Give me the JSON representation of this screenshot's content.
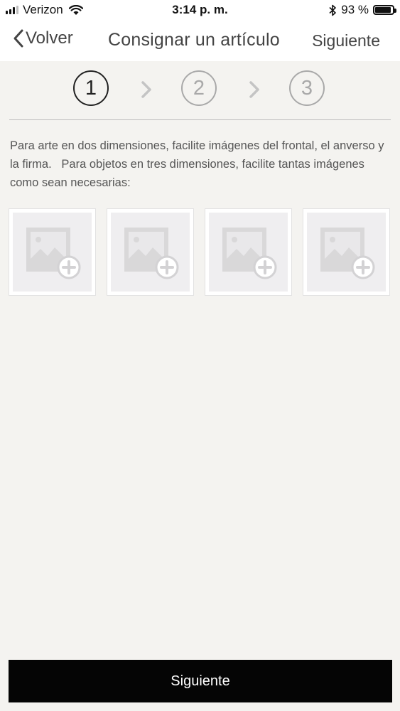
{
  "status_bar": {
    "carrier": "Verizon",
    "time": "3:14 p. m.",
    "battery_percent": "93 %",
    "battery_level": 0.93,
    "icons": [
      "signal-icon",
      "wifi-icon",
      "bluetooth-icon",
      "battery-icon"
    ]
  },
  "nav": {
    "back_label": "Volver",
    "title": "Consignar un artículo",
    "next_label": "Siguiente",
    "icons": [
      "chevron-left-icon"
    ]
  },
  "steps": [
    {
      "label": "1",
      "state": "active"
    },
    {
      "label": "2",
      "state": "inactive"
    },
    {
      "label": "3",
      "state": "inactive"
    }
  ],
  "instructions": "Para arte en dos dimensiones, facilite imágenes del frontal, el anverso y la firma.   Para objetos en tres dimensiones, facilite tantas imágenes como sean necesarias:",
  "image_slots": [
    {
      "icon": "add-image-icon"
    },
    {
      "icon": "add-image-icon"
    },
    {
      "icon": "add-image-icon"
    },
    {
      "icon": "add-image-icon"
    }
  ],
  "footer": {
    "button_label": "Siguiente"
  },
  "colors": {
    "background": "#f4f3f0",
    "header": "#ffffff",
    "button": "#050505",
    "step_active": "#222222",
    "step_inactive": "#a9a9a9"
  }
}
